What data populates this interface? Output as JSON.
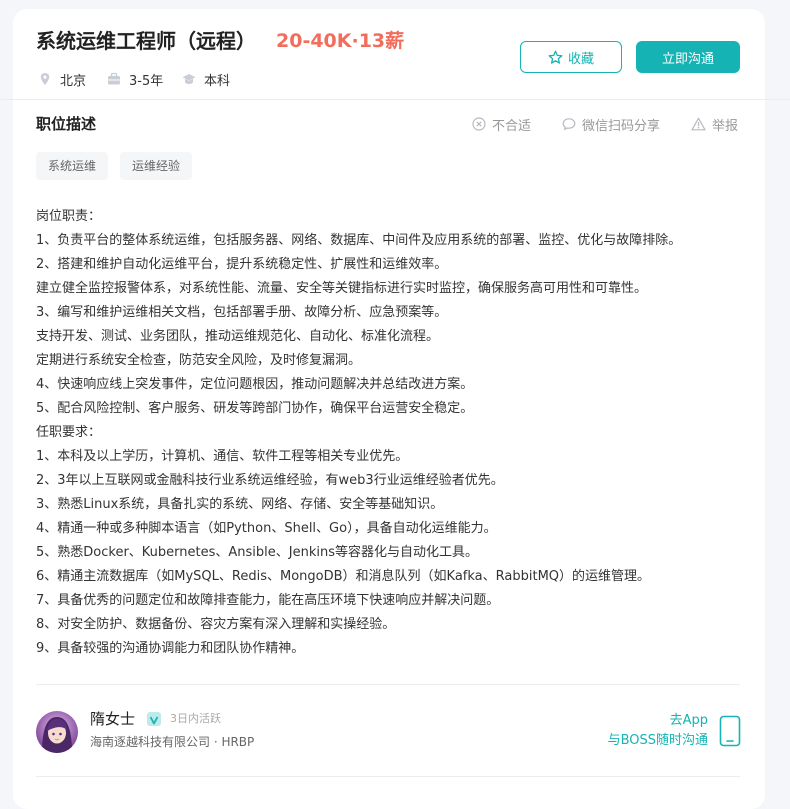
{
  "job": {
    "title": "系统运维工程师（远程）",
    "salary": "20-40K·13薪",
    "location": "北京",
    "experience": "3-5年",
    "education": "本科"
  },
  "actions": {
    "favorite_label": "收藏",
    "chat_label": "立即沟通"
  },
  "section": {
    "title": "职位描述",
    "not_suitable": "不合适",
    "wechat_share": "微信扫码分享",
    "report": "举报"
  },
  "tags": [
    "系统运维",
    "运维经验"
  ],
  "description": [
    "岗位职责：",
    "1、负责平台的整体系统运维，包括服务器、网络、数据库、中间件及应用系统的部署、监控、优化与故障排除。",
    "2、搭建和维护自动化运维平台，提升系统稳定性、扩展性和运维效率。",
    "建立健全监控报警体系，对系统性能、流量、安全等关键指标进行实时监控，确保服务高可用性和可靠性。",
    "3、编写和维护运维相关文档，包括部署手册、故障分析、应急预案等。",
    "支持开发、测试、业务团队，推动运维规范化、自动化、标准化流程。",
    "定期进行系统安全检查，防范安全风险，及时修复漏洞。",
    "4、快速响应线上突发事件，定位问题根因，推动问题解决并总结改进方案。",
    "5、配合风险控制、客户服务、研发等跨部门协作，确保平台运营安全稳定。",
    "任职要求：",
    "1、本科及以上学历，计算机、通信、软件工程等相关专业优先。",
    "2、3年以上互联网或金融科技行业系统运维经验，有web3行业运维经验者优先。",
    "3、熟悉Linux系统，具备扎实的系统、网络、存储、安全等基础知识。",
    "4、精通一种或多种脚本语言（如Python、Shell、Go），具备自动化运维能力。",
    "5、熟悉Docker、Kubernetes、Ansible、Jenkins等容器化与自动化工具。",
    "6、精通主流数据库（如MySQL、Redis、MongoDB）和消息队列（如Kafka、RabbitMQ）的运维管理。",
    "7、具备优秀的问题定位和故障排查能力，能在高压环境下快速响应并解决问题。",
    "8、对安全防护、数据备份、容灾方案有深入理解和实操经验。",
    "9、具备较强的沟通协调能力和团队协作精神。"
  ],
  "recruiter": {
    "name": "隋女士",
    "active": "3日内活跃",
    "company_role": "海南逐越科技有限公司 · HRBP",
    "app_line1": "去App",
    "app_line2": "与BOSS随时沟通"
  },
  "colors": {
    "accent": "#15b3b3",
    "salary": "#f26d5b"
  },
  "icons": {
    "location": "location-pin-icon",
    "experience": "briefcase-icon",
    "education": "graduation-cap-icon",
    "favorite": "star-icon",
    "not_suitable": "close-circle-icon",
    "share": "chat-bubble-icon",
    "report": "warning-icon",
    "phone": "phone-icon",
    "verified": "verified-badge-icon"
  }
}
